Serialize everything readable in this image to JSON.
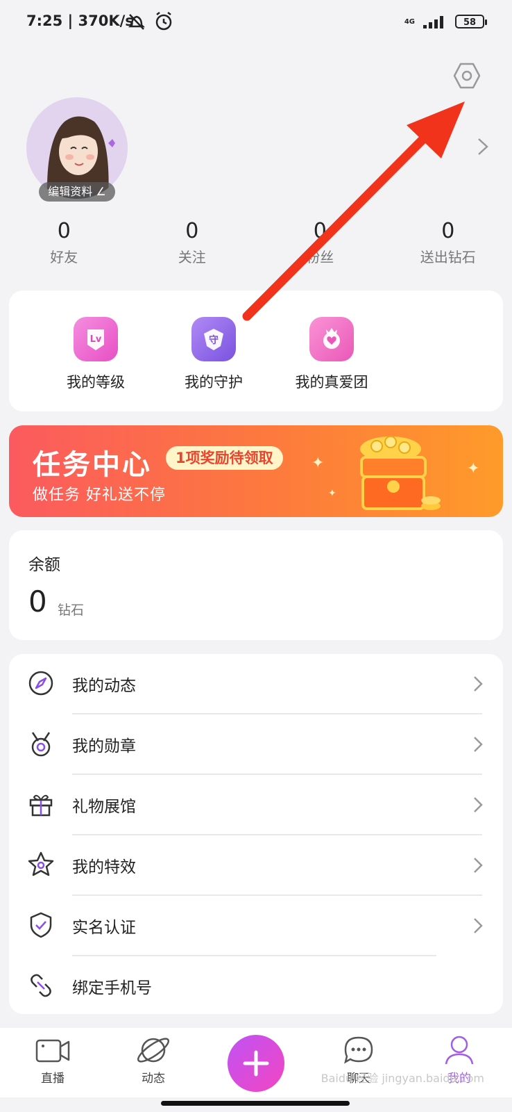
{
  "status_bar": {
    "time": "7:25",
    "speed": "370K/s",
    "network": "4G",
    "battery": "58"
  },
  "profile": {
    "edit_label": "编辑资料"
  },
  "stats": [
    {
      "value": "0",
      "label": "好友"
    },
    {
      "value": "0",
      "label": "关注"
    },
    {
      "value": "0",
      "label": "粉丝"
    },
    {
      "value": "0",
      "label": "送出钻石"
    }
  ],
  "features": [
    {
      "label": "我的等级",
      "icon": "level-icon"
    },
    {
      "label": "我的守护",
      "icon": "guard-icon"
    },
    {
      "label": "我的真爱团",
      "icon": "fan-club-icon"
    }
  ],
  "banner": {
    "title": "任务中心",
    "badge": "1项奖励待领取",
    "subtitle": "做任务 好礼送不停"
  },
  "balance": {
    "title": "余额",
    "amount": "0",
    "unit": "钻石"
  },
  "menu": [
    {
      "label": "我的动态",
      "icon": "compass-icon"
    },
    {
      "label": "我的勋章",
      "icon": "medal-icon"
    },
    {
      "label": "礼物展馆",
      "icon": "gift-icon"
    },
    {
      "label": "我的特效",
      "icon": "star-icon"
    },
    {
      "label": "实名认证",
      "icon": "shield-check-icon"
    },
    {
      "label": "绑定手机号",
      "icon": "link-icon"
    }
  ],
  "tabs": [
    {
      "label": "直播",
      "icon": "camera-icon"
    },
    {
      "label": "动态",
      "icon": "planet-icon"
    },
    {
      "label": "聊天",
      "icon": "chat-icon"
    },
    {
      "label": "我的",
      "icon": "profile-icon",
      "active": true
    }
  ],
  "accent_color": "#a05ce8",
  "watermark": "Baidu 经验 jingyan.baidu.com"
}
